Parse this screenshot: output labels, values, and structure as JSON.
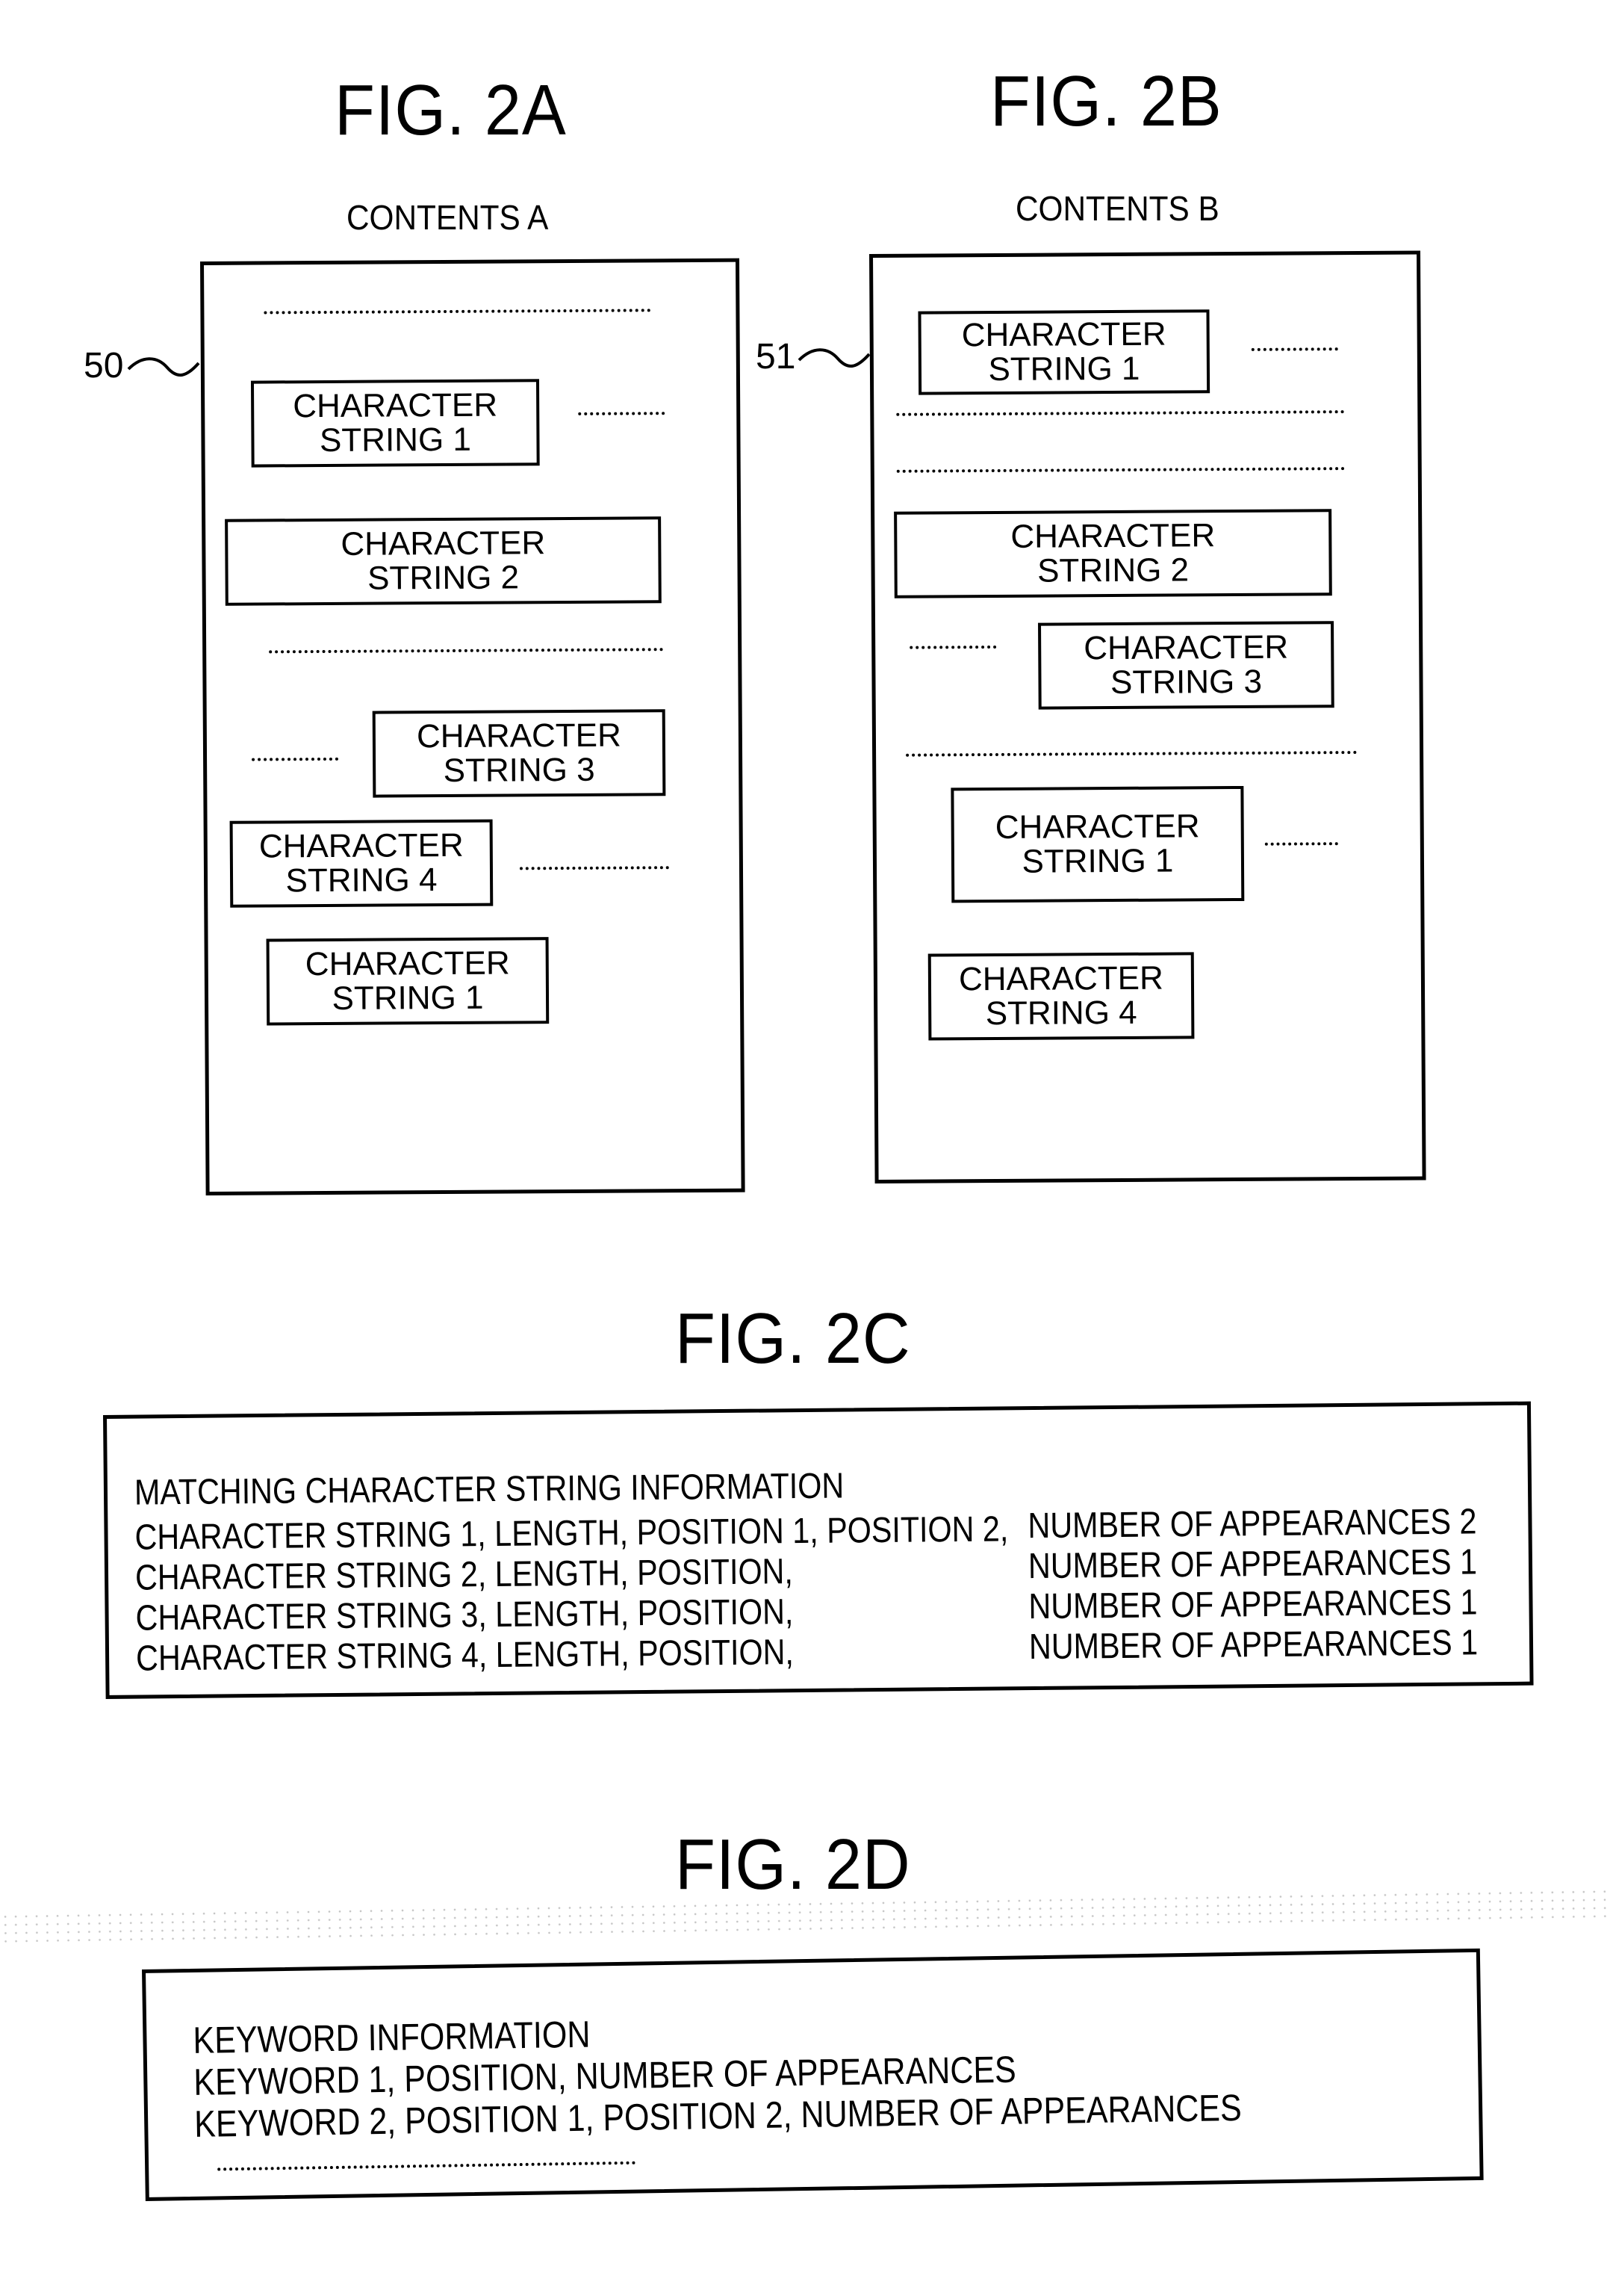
{
  "figures": {
    "fig2a": {
      "title": "FIG. 2A",
      "contents_label": "CONTENTS A",
      "ref_number": "50",
      "boxes": [
        {
          "line1": "CHARACTER",
          "line2": "STRING 1"
        },
        {
          "line1": "CHARACTER",
          "line2": "STRING 2"
        },
        {
          "line1": "CHARACTER",
          "line2": "STRING 3"
        },
        {
          "line1": "CHARACTER",
          "line2": "STRING 4"
        },
        {
          "line1": "CHARACTER",
          "line2": "STRING 1"
        }
      ]
    },
    "fig2b": {
      "title": "FIG. 2B",
      "contents_label": "CONTENTS B",
      "ref_number": "51",
      "boxes": [
        {
          "line1": "CHARACTER",
          "line2": "STRING 1"
        },
        {
          "line1": "CHARACTER",
          "line2": "STRING 2"
        },
        {
          "line1": "CHARACTER",
          "line2": "STRING 3"
        },
        {
          "line1": "CHARACTER",
          "line2": "STRING 1"
        },
        {
          "line1": "CHARACTER",
          "line2": "STRING 4"
        }
      ]
    },
    "fig2c": {
      "title": "FIG. 2C",
      "heading": "MATCHING CHARACTER STRING INFORMATION",
      "rows": [
        {
          "left": "CHARACTER STRING 1, LENGTH, POSITION 1, POSITION 2,",
          "right": "NUMBER OF APPEARANCES 2"
        },
        {
          "left": "CHARACTER STRING 2, LENGTH, POSITION,",
          "right": "NUMBER OF APPEARANCES 1"
        },
        {
          "left": "CHARACTER STRING 3, LENGTH, POSITION,",
          "right": "NUMBER OF APPEARANCES 1"
        },
        {
          "left": "CHARACTER STRING 4, LENGTH, POSITION,",
          "right": "NUMBER OF APPEARANCES 1"
        }
      ]
    },
    "fig2d": {
      "title": "FIG. 2D",
      "heading": "KEYWORD INFORMATION",
      "rows": [
        "KEYWORD 1, POSITION, NUMBER OF APPEARANCES",
        "KEYWORD 2, POSITION 1, POSITION 2, NUMBER OF APPEARANCES"
      ]
    }
  }
}
